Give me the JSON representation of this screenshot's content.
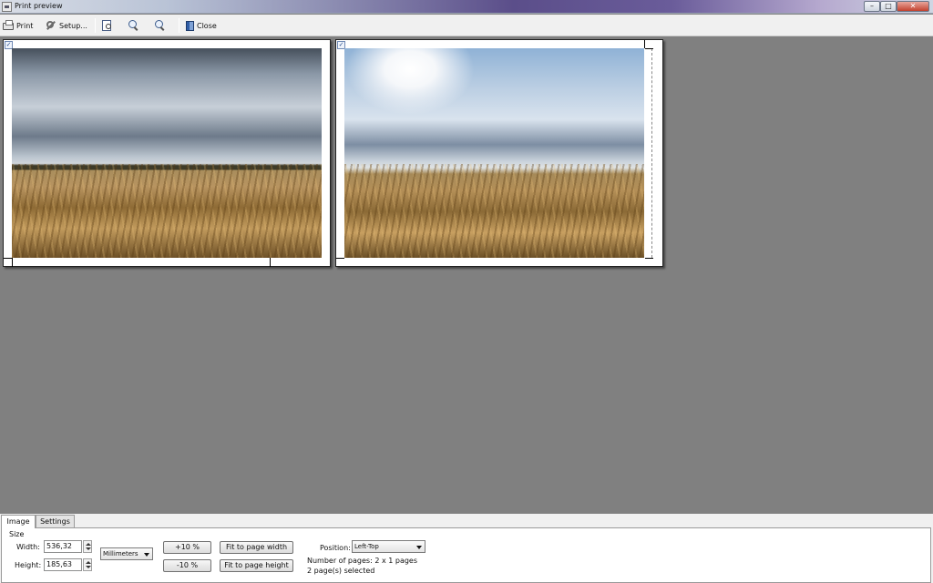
{
  "window": {
    "title": "Print preview",
    "minimize_label": "–",
    "maximize_label": "□",
    "close_label": "✕"
  },
  "toolbar": {
    "print_label": "Print",
    "setup_label": "Setup...",
    "close_label": "Close"
  },
  "preview": {
    "pages": [
      {
        "checked": true,
        "check_glyph": "✓"
      },
      {
        "checked": true,
        "check_glyph": "✓"
      }
    ]
  },
  "tabs": {
    "image_label": "Image",
    "settings_label": "Settings"
  },
  "image_tab": {
    "size_group_label": "Size",
    "width_label": "Width:",
    "width_value": "536,32",
    "height_label": "Height:",
    "height_value": "185,63",
    "units_value": "Millimeters",
    "plus_button": "+10 %",
    "minus_button": "-10 %",
    "fit_width_button": "Fit to page width",
    "fit_height_button": "Fit to page height",
    "position_label": "Position:",
    "position_value": "Left-Top",
    "pages_info": "Number of pages: 2 x 1 pages",
    "selected_info": "2 page(s) selected"
  }
}
